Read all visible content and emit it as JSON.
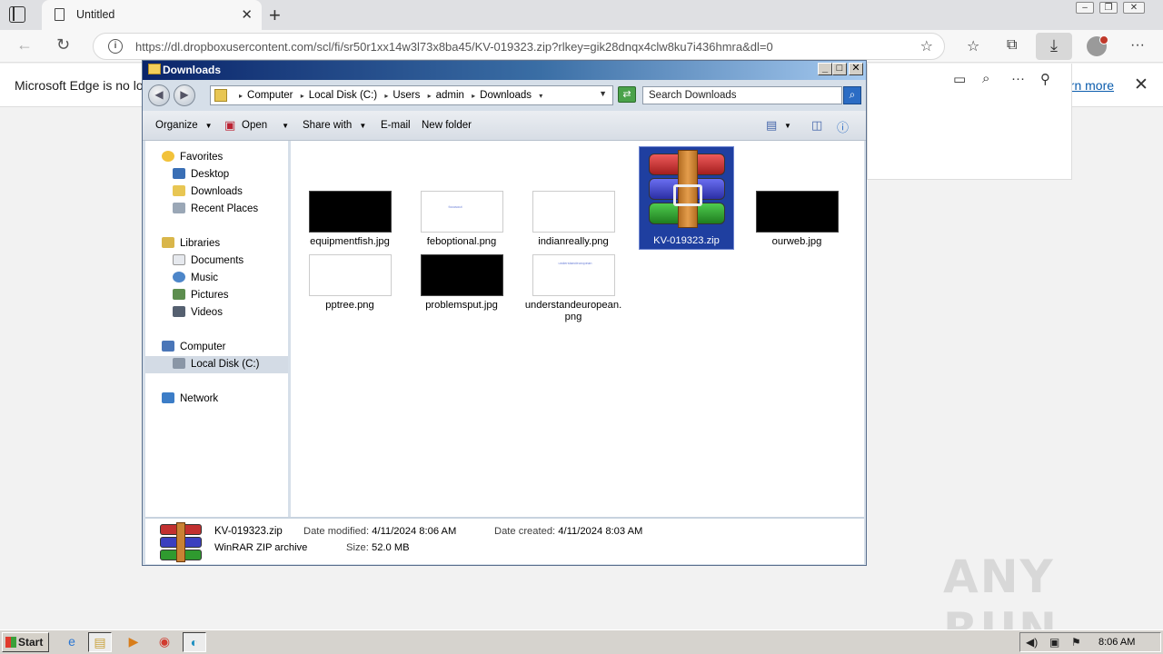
{
  "browser": {
    "tab_title": "Untitled",
    "url": "https://dl.dropboxusercontent.com/scl/fi/sr50r1xx14w3l73x8ba45/KV-019323.zip?rlkey=gik28dnqx4clw8ku7i436hmra&dl=0",
    "infobar_message": "Microsoft Edge is no lo",
    "infobar_link": "arn more"
  },
  "explorer": {
    "title": "Downloads",
    "breadcrumbs": [
      "Computer",
      "Local Disk (C:)",
      "Users",
      "admin",
      "Downloads"
    ],
    "search_placeholder": "Search Downloads",
    "commands": {
      "organize": "Organize",
      "open": "Open",
      "share_with": "Share with",
      "email": "E-mail",
      "new_folder": "New folder"
    },
    "nav": {
      "favorites": "Favorites",
      "desktop": "Desktop",
      "downloads": "Downloads",
      "recent_places": "Recent Places",
      "libraries": "Libraries",
      "documents": "Documents",
      "music": "Music",
      "pictures": "Pictures",
      "videos": "Videos",
      "computer": "Computer",
      "local_disk": "Local Disk (C:)",
      "network": "Network"
    },
    "files": [
      {
        "name": "equipmentfish.jpg",
        "thumb": "dark"
      },
      {
        "name": "feboptional.png",
        "thumb": "light",
        "thumb_text": "focusout"
      },
      {
        "name": "indianreally.png",
        "thumb": "light"
      },
      {
        "name": "KV-019323.zip",
        "thumb": "winrar",
        "selected": true
      },
      {
        "name": "ourweb.jpg",
        "thumb": "dark"
      },
      {
        "name": "pptree.png",
        "thumb": "light"
      },
      {
        "name": "problemsput.jpg",
        "thumb": "dark"
      },
      {
        "name": "understandeuropean.png",
        "thumb": "light",
        "thumb_text": "understandeuropean"
      }
    ],
    "details": {
      "name": "KV-019323.zip",
      "type": "WinRAR ZIP archive",
      "modified_label": "Date modified:",
      "modified_value": "4/11/2024 8:06 AM",
      "created_label": "Date created:",
      "created_value": "4/11/2024 8:03 AM",
      "size_label": "Size:",
      "size_value": "52.0 MB"
    }
  },
  "taskbar": {
    "start_label": "Start",
    "clock": "8:06 AM"
  },
  "watermark": "ANY RUN"
}
